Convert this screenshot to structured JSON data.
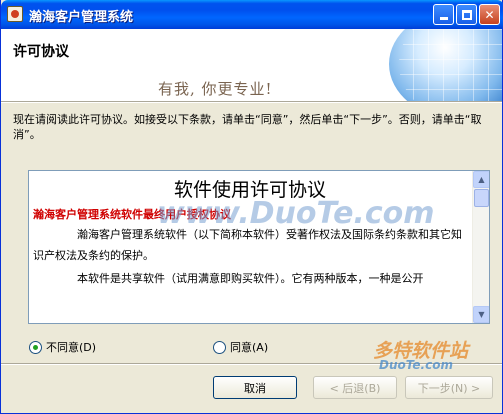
{
  "window": {
    "title": "瀚海客户管理系统"
  },
  "header": {
    "title": "许可协议",
    "slogan": "有我, 你更专业!"
  },
  "instruction": "现在请阅读此许可协议。如接受以下条款，请单击“同意”，然后单击“下一步”。否则，请单击“取消”。",
  "license": {
    "title": "软件使用许可协议",
    "subtitle": "瀚海客户管理系统软件最终用户授权协议",
    "paragraphs": [
      "瀚海客户管理系统软件（以下简称本软件）受著作权法及国际条约条款和其它知识产权法及条约的保护。",
      "本软件是共享软件（试用满意即购买软件）。它有两种版本，一种是公开"
    ]
  },
  "options": {
    "disagree": "不同意(D)",
    "agree": "同意(A)",
    "selected": "disagree"
  },
  "buttons": {
    "cancel": "取消",
    "back": "< 后退(B)",
    "next": "下一步(N) >"
  },
  "watermarks": {
    "site1": "www.DuoTe.com",
    "site2": "多特软件站",
    "site3": "DuoTe.com"
  },
  "colors": {
    "titlebar": "#0053ee",
    "accent_red": "#d00000",
    "radio_selected": "#21a121"
  }
}
